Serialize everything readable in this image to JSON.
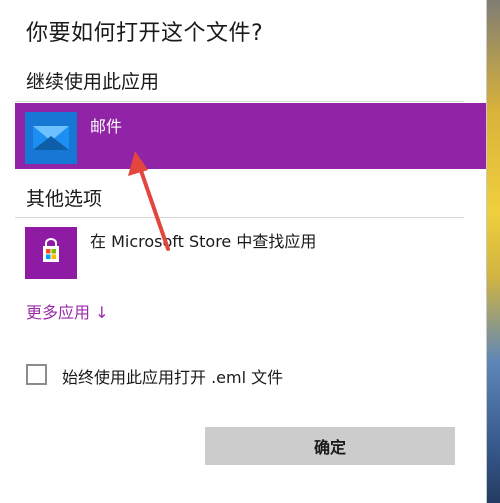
{
  "dialog": {
    "title": "你要如何打开这个文件?",
    "continue_section": "继续使用此应用",
    "other_section": "其他选项",
    "apps": [
      {
        "label": "邮件",
        "icon": "mail-icon",
        "selected": true
      },
      {
        "label": "在 Microsoft Store 中查找应用",
        "icon": "microsoft-store-icon",
        "selected": false
      }
    ],
    "more_apps": "更多应用 ↓",
    "checkbox_label": "始终使用此应用打开 .eml 文件",
    "checkbox_checked": false,
    "ok_button": "确定",
    "accent_color": "#9123a6",
    "mail_color": "#1677d4"
  },
  "annotation": {
    "arrow_color": "#e2463e"
  }
}
